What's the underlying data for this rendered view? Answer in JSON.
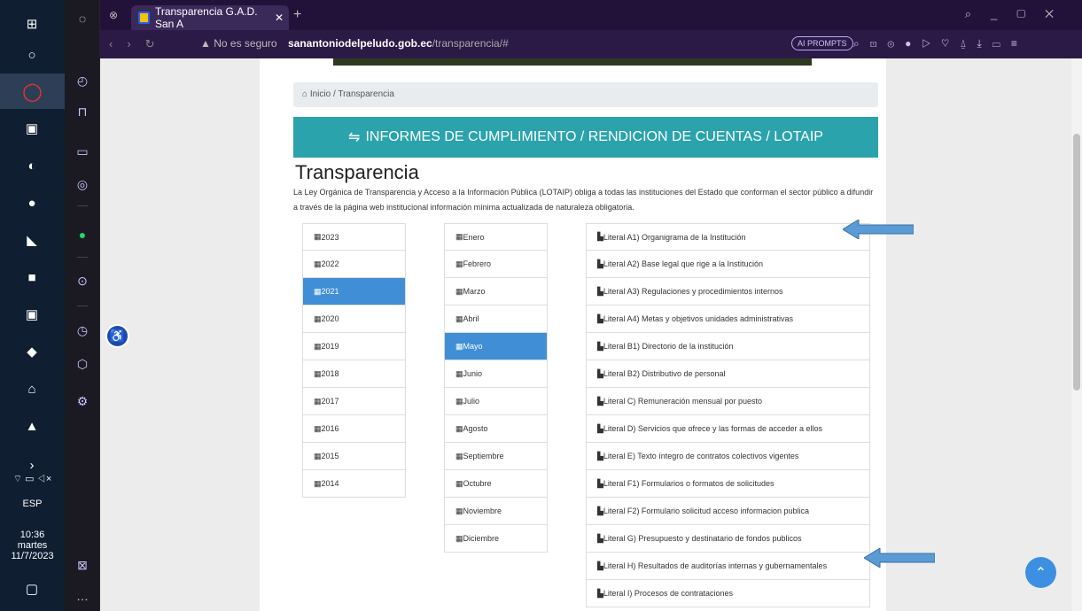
{
  "taskbar": {
    "lang": "ESP",
    "time": "10:36",
    "day": "martes",
    "date": "11/7/2023"
  },
  "browser": {
    "tab_title": "Transparencia G.A.D. San A",
    "insecure": "No es seguro",
    "url_domain": "sanantoniodelpeludo.gob.ec",
    "url_path": "/transparencia/#",
    "ai_prompts": "AI PROMPTS"
  },
  "page": {
    "breadcrumb_home": "Inicio",
    "breadcrumb_sep": "/",
    "breadcrumb_current": "Transparencia",
    "header": "INFORMES DE CUMPLIMIENTO / RENDICION DE CUENTAS / LOTAIP",
    "title": "Transparencia",
    "intro": "La Ley Orgánica de Transparencia y Acceso a la Información Pública (LOTAIP) obliga a todas las instituciones del Estado que conforman el sector público a difundir a través de la página web institucional información mínima actualizada de naturaleza obligatoria."
  },
  "years": [
    "2023",
    "2022",
    "2021",
    "2020",
    "2019",
    "2018",
    "2017",
    "2016",
    "2015",
    "2014"
  ],
  "months": [
    "Enero",
    "Febrero",
    "Marzo",
    "Abril",
    "Mayo",
    "Junio",
    "Julio",
    "Agosto",
    "Septiembre",
    "Octubre",
    "Noviembre",
    "Diciembre"
  ],
  "literals": [
    "Literal A1) Organigrama de la Institución",
    "Literal A2) Base legal que rige a la Institución",
    "Literal A3) Regulaciones y procedimientos internos",
    "Literal A4) Metas y objetivos unidades administrativas",
    "Literal B1) Directorio de la institución",
    "Literal B2) Distributivo de personal",
    "Literal C) Remuneración mensual por puesto",
    "Literal D) Servicios que ofrece y las formas de acceder a ellos",
    "Literal E) Texto íntegro de contratos colectivos vigentes",
    "Literal F1) Formularios o formatos de solicitudes",
    "Literal F2) Formulario solicitud acceso informacion publica",
    "Literal G) Presupuesto y destinatario de fondos publicos",
    "Literal H) Resultados de auditorías internas y gubernamentales",
    "Literal I) Procesos de contrataciones"
  ],
  "selected_year": "2021",
  "selected_month": "Mayo"
}
